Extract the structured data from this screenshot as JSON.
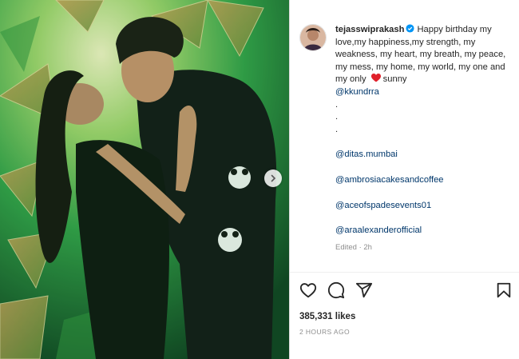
{
  "post": {
    "author": "tejasswiprakash",
    "caption_text": "Happy birthday my love,my happiness,my strength, my weakness, my heart, my breath, my peace, my mess, my home, my world, my one and my only",
    "caption_after_heart": "sunny",
    "mentions": [
      "@kkundrra",
      "@ditas.mumbai",
      "@ambrosiacakesandcoffee",
      "@aceofspadesevents01",
      "@araalexanderofficial"
    ],
    "dots": [
      ".",
      ".",
      "."
    ],
    "edited": "Edited · 2h",
    "likes": "385,331 likes",
    "timestamp": "2 HOURS AGO"
  },
  "icons": {
    "verified": "verified-badge-icon",
    "heart_emoji": "red-heart-emoji",
    "like": "heart-outline-icon",
    "comment": "comment-bubble-icon",
    "share": "paper-plane-icon",
    "save": "bookmark-icon",
    "next": "chevron-right-icon"
  },
  "colors": {
    "link": "#00376b",
    "verified_blue": "#0095f6",
    "muted": "#8e8e8e",
    "text": "#262626",
    "photo_green": "#1f8a3a"
  }
}
